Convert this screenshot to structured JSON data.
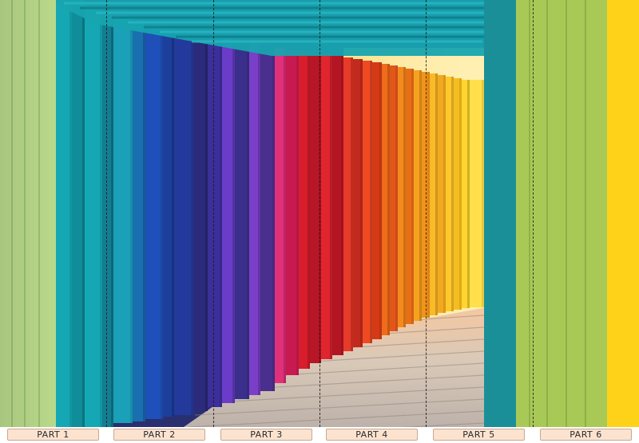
{
  "image": {
    "subject": "rainbow-tunnel-wall-mural-photo",
    "colors": {
      "green": "#b7d57a",
      "teal": "#15a7b4",
      "blue": "#1f4fb8",
      "indigo": "#2c2a7a",
      "purple": "#6a3cc8",
      "magenta": "#e1307a",
      "red": "#d81d2c",
      "orange": "#f06b1a",
      "yellow": "#ffd21a",
      "floor": "#d9c9b8"
    }
  },
  "panels": {
    "labels": [
      "PART 1",
      "PART 2",
      "PART 3",
      "PART 4",
      "PART 5",
      "PART 6"
    ]
  }
}
